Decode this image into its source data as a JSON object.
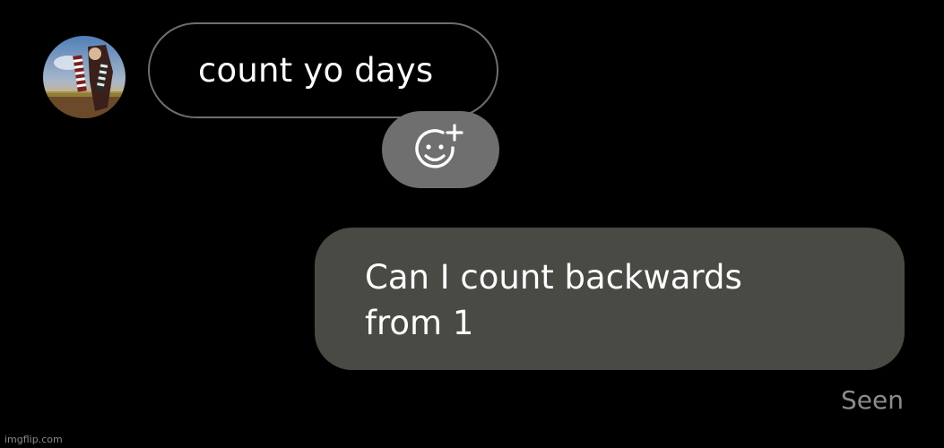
{
  "chat": {
    "incoming_message": "count yo days",
    "outgoing_message": "Can I count backwards from 1",
    "seen_status": "Seen"
  },
  "icons": {
    "avatar": "user-avatar",
    "react": "add-reaction-smiley-icon"
  },
  "colors": {
    "background": "#000000",
    "incoming_border": "#6e6e6e",
    "outgoing_bubble": "#4a4a45",
    "react_button": "#6f6f6f",
    "seen_text": "#8c8c8c"
  },
  "watermark": "imgflip.com"
}
